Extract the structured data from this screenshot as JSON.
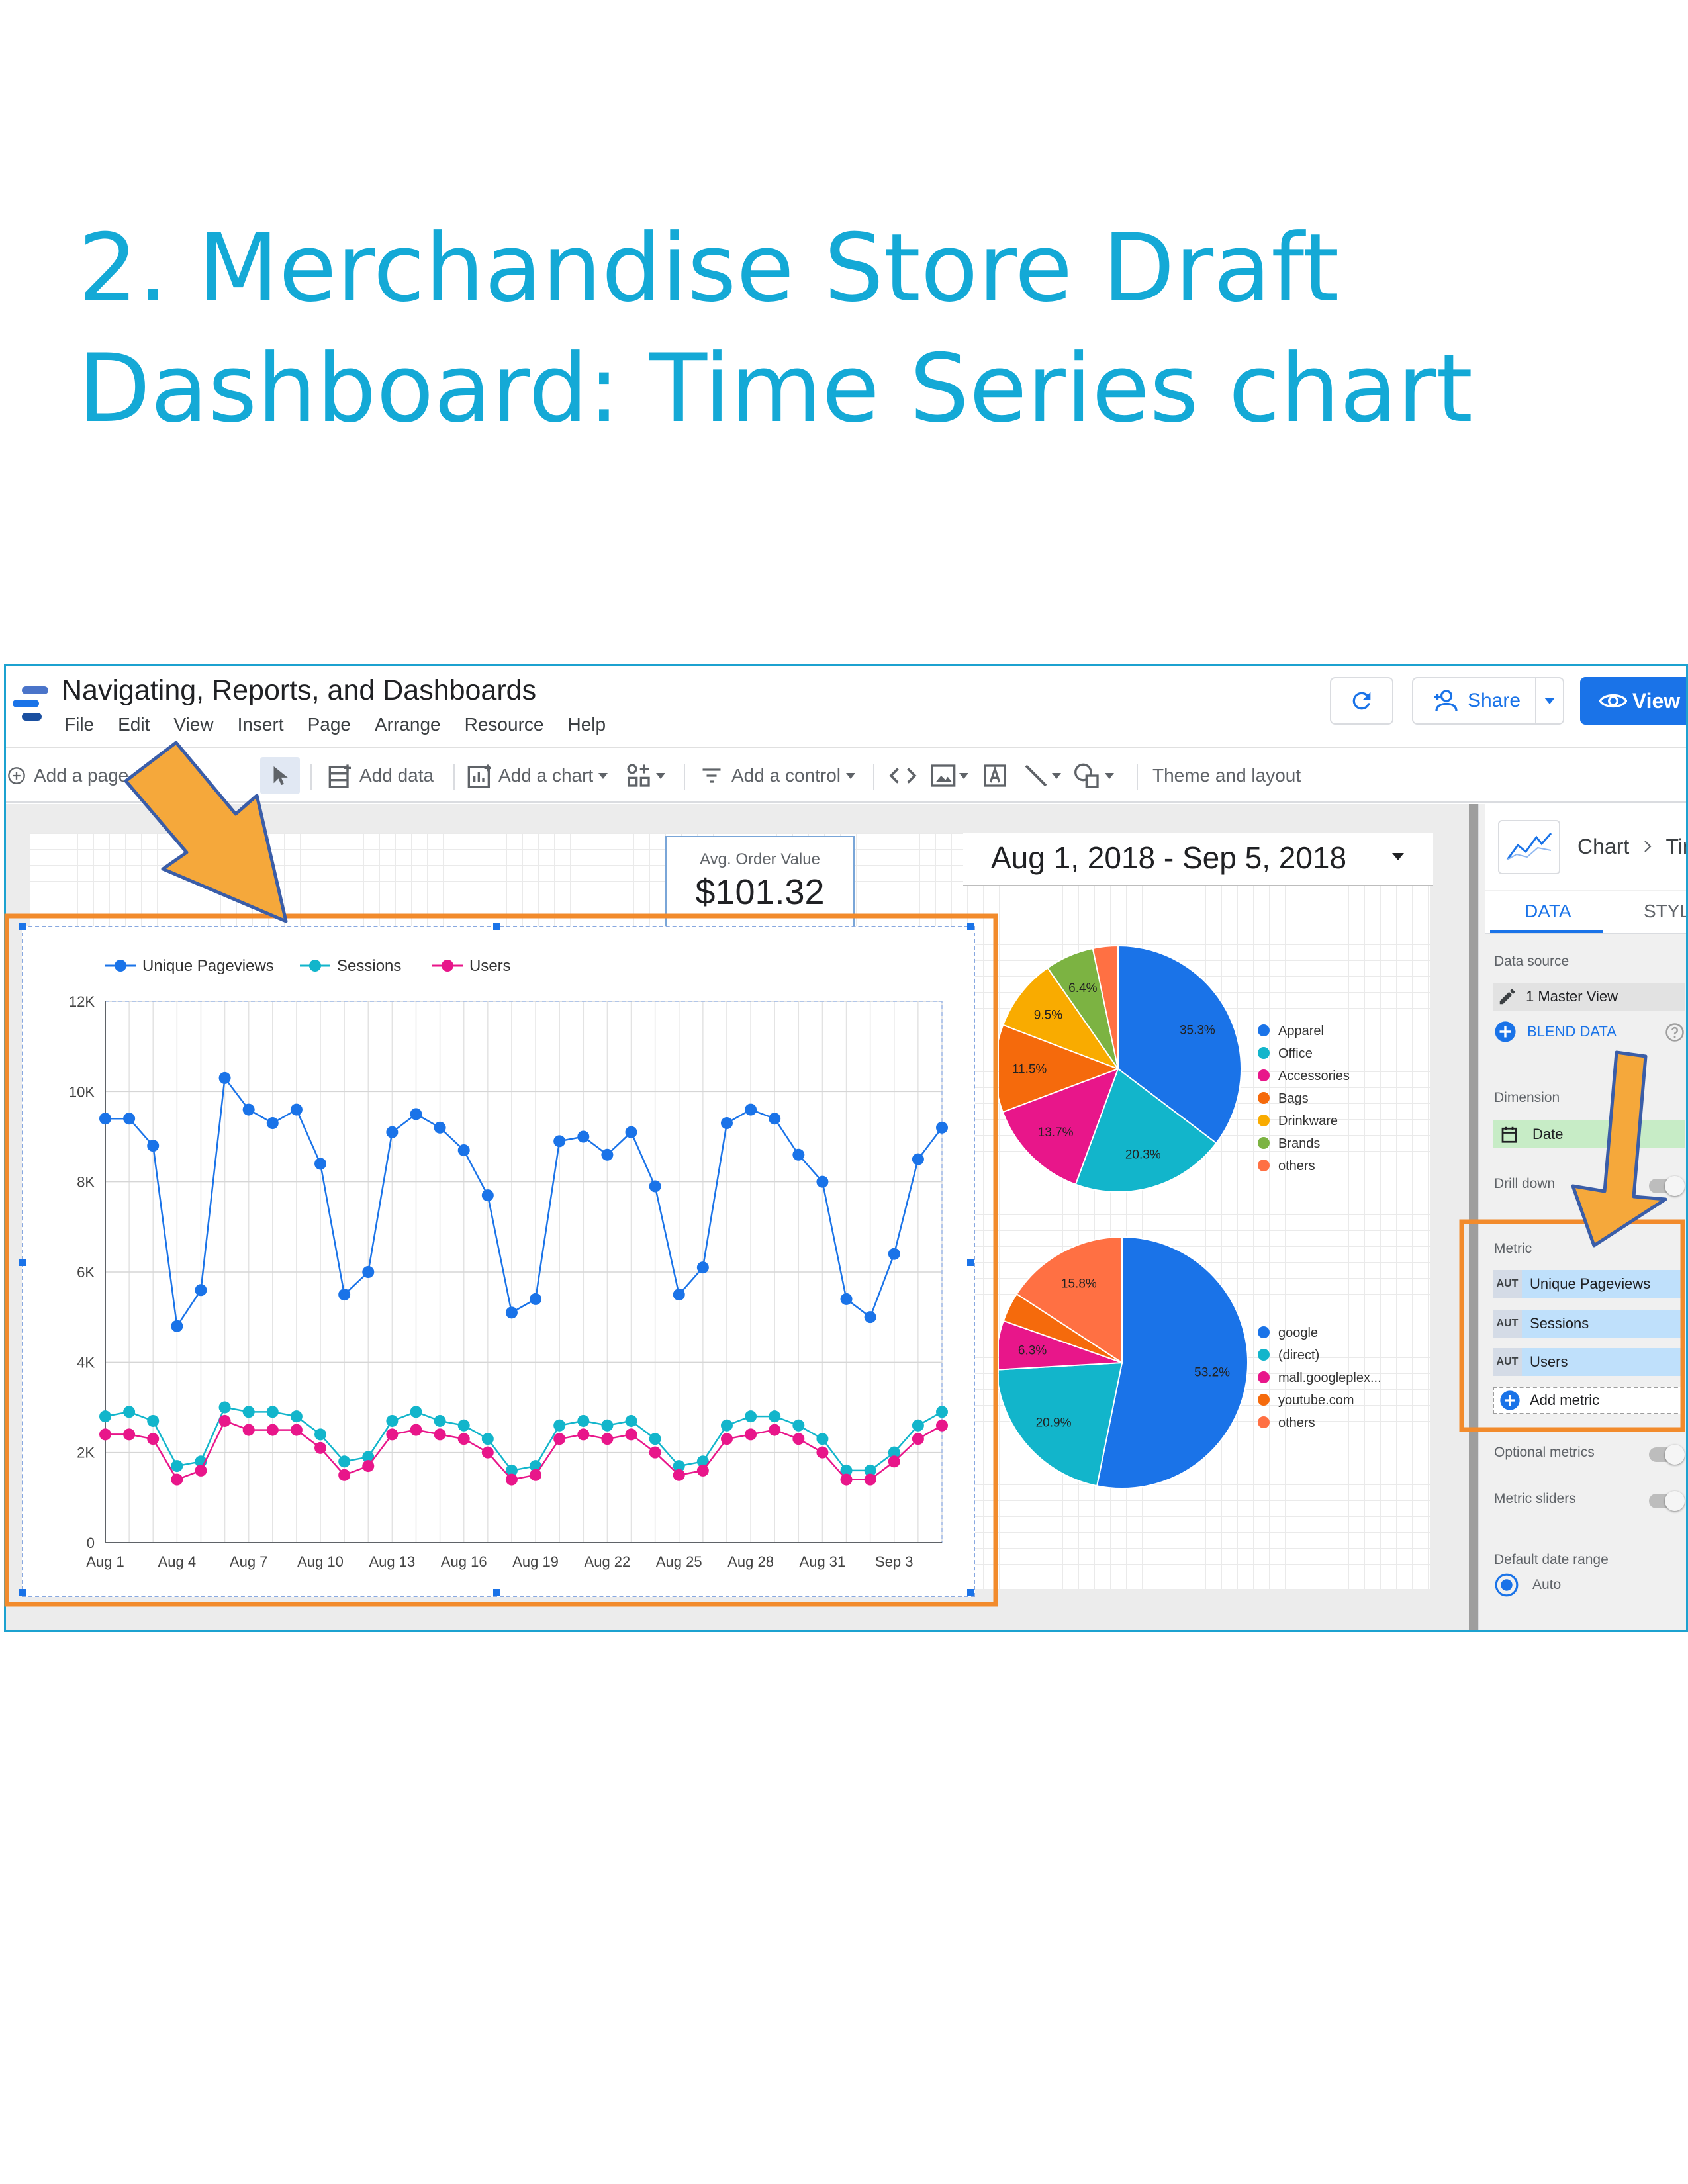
{
  "slide": {
    "title_line1": "2. Merchandise Store Draft",
    "title_line2": "Dashboard: Time Series chart"
  },
  "app": {
    "doc_title": "Navigating, Reports, and Dashboards",
    "menu": [
      "File",
      "Edit",
      "View",
      "Insert",
      "Page",
      "Arrange",
      "Resource",
      "Help"
    ],
    "share_label": "Share",
    "view_label": "View"
  },
  "toolbar": {
    "add_page": "Add a page",
    "add_data": "Add data",
    "add_chart": "Add a chart",
    "add_control": "Add a control",
    "theme_layout": "Theme and layout"
  },
  "kpi": {
    "label": "Avg. Order Value",
    "value": "$101.32"
  },
  "date_range": {
    "value": "Aug 1, 2018 - Sep 5, 2018"
  },
  "colors": {
    "unique_pageviews": "#1a73e8",
    "sessions": "#12b5cb",
    "users": "#e8168a",
    "brand": "#14a9d6",
    "accent": "#1a73e8",
    "annotation": "#f28b2c",
    "arrow_fill": "#f5a83b",
    "arrow_stroke": "#3a5da8"
  },
  "panel": {
    "crumb_chart": "Chart",
    "crumb_rest": "Tim",
    "tab_data": "DATA",
    "tab_style": "STYLE",
    "data_source_label": "Data source",
    "data_source_value": "1 Master View",
    "blend_label": "BLEND DATA",
    "dimension_label": "Dimension",
    "dimension_value": "Date",
    "drill_down_label": "Drill down",
    "metric_label": "Metric",
    "aut_tag": "AUT",
    "metrics": [
      "Unique Pageviews",
      "Sessions",
      "Users"
    ],
    "add_metric": "Add metric",
    "optional_metrics_label": "Optional metrics",
    "metric_sliders_label": "Metric sliders",
    "default_date_range_label": "Default date range",
    "auto_label": "Auto"
  },
  "icons": [
    "refresh-icon",
    "person-add-icon",
    "eye-icon",
    "undo-icon",
    "pointer-icon",
    "pencil-icon",
    "help-icon",
    "calendar-icon",
    "plus-circle-icon",
    "chevron-right-icon"
  ],
  "chart_data": [
    {
      "type": "line",
      "x_tick_labels": [
        "Aug 1",
        "Aug 4",
        "Aug 7",
        "Aug 10",
        "Aug 13",
        "Aug 16",
        "Aug 19",
        "Aug 22",
        "Aug 25",
        "Aug 28",
        "Aug 31",
        "Sep 3"
      ],
      "y_tick_labels": [
        "0",
        "2K",
        "4K",
        "6K",
        "8K",
        "10K",
        "12K"
      ],
      "ylim": [
        0,
        12000
      ],
      "grid": true,
      "legend_position": "top-left",
      "x": [
        "2018-08-01",
        "2018-08-02",
        "2018-08-03",
        "2018-08-04",
        "2018-08-05",
        "2018-08-06",
        "2018-08-07",
        "2018-08-08",
        "2018-08-09",
        "2018-08-10",
        "2018-08-11",
        "2018-08-12",
        "2018-08-13",
        "2018-08-14",
        "2018-08-15",
        "2018-08-16",
        "2018-08-17",
        "2018-08-18",
        "2018-08-19",
        "2018-08-20",
        "2018-08-21",
        "2018-08-22",
        "2018-08-23",
        "2018-08-24",
        "2018-08-25",
        "2018-08-26",
        "2018-08-27",
        "2018-08-28",
        "2018-08-29",
        "2018-08-30",
        "2018-08-31",
        "2018-09-01",
        "2018-09-02",
        "2018-09-03",
        "2018-09-04",
        "2018-09-05"
      ],
      "series": [
        {
          "name": "Unique Pageviews",
          "values": [
            9400,
            9400,
            8800,
            4800,
            5600,
            10300,
            9600,
            9300,
            9600,
            8400,
            5500,
            6000,
            9100,
            9500,
            9200,
            8700,
            7700,
            5100,
            5400,
            8900,
            9000,
            8600,
            9100,
            7900,
            5500,
            6100,
            9300,
            9600,
            9400,
            8600,
            8000,
            5400,
            5000,
            6400,
            8500,
            9200
          ]
        },
        {
          "name": "Sessions",
          "values": [
            2800,
            2900,
            2700,
            1700,
            1800,
            3000,
            2900,
            2900,
            2800,
            2400,
            1800,
            1900,
            2700,
            2900,
            2700,
            2600,
            2300,
            1600,
            1700,
            2600,
            2700,
            2600,
            2700,
            2300,
            1700,
            1800,
            2600,
            2800,
            2800,
            2600,
            2300,
            1600,
            1600,
            2000,
            2600,
            2900
          ]
        },
        {
          "name": "Users",
          "values": [
            2400,
            2400,
            2300,
            1400,
            1600,
            2700,
            2500,
            2500,
            2500,
            2100,
            1500,
            1700,
            2400,
            2500,
            2400,
            2300,
            2000,
            1400,
            1500,
            2300,
            2400,
            2300,
            2400,
            2000,
            1500,
            1600,
            2300,
            2400,
            2500,
            2300,
            2000,
            1400,
            1400,
            1800,
            2300,
            2600
          ]
        }
      ]
    },
    {
      "type": "pie",
      "legend_position": "right",
      "slices": [
        {
          "label": "Apparel",
          "value": 35.3,
          "text": "35.3%",
          "color": "#1a73e8"
        },
        {
          "label": "Office",
          "value": 20.3,
          "text": "20.3%",
          "color": "#12b5cb"
        },
        {
          "label": "Accessories",
          "value": 13.7,
          "text": "13.7%",
          "color": "#e8168a"
        },
        {
          "label": "Bags",
          "value": 11.5,
          "text": "11.5%",
          "color": "#f56a0c"
        },
        {
          "label": "Drinkware",
          "value": 9.5,
          "text": "9.5%",
          "color": "#f9ab00"
        },
        {
          "label": "Brands",
          "value": 6.4,
          "text": "6.4%",
          "color": "#7cb342"
        },
        {
          "label": "others",
          "value": 3.3,
          "text": "",
          "color": "#ff7043"
        }
      ]
    },
    {
      "type": "pie",
      "legend_position": "right",
      "slices": [
        {
          "label": "google",
          "value": 53.2,
          "text": "53.2%",
          "color": "#1a73e8"
        },
        {
          "label": "(direct)",
          "value": 20.9,
          "text": "20.9%",
          "color": "#12b5cb"
        },
        {
          "label": "mall.googleplex...",
          "value": 6.3,
          "text": "6.3%",
          "color": "#e8168a"
        },
        {
          "label": "youtube.com",
          "value": 3.8,
          "text": "",
          "color": "#f56a0c"
        },
        {
          "label": "others",
          "value": 15.8,
          "text": "15.8%",
          "color": "#ff7043"
        }
      ]
    }
  ]
}
